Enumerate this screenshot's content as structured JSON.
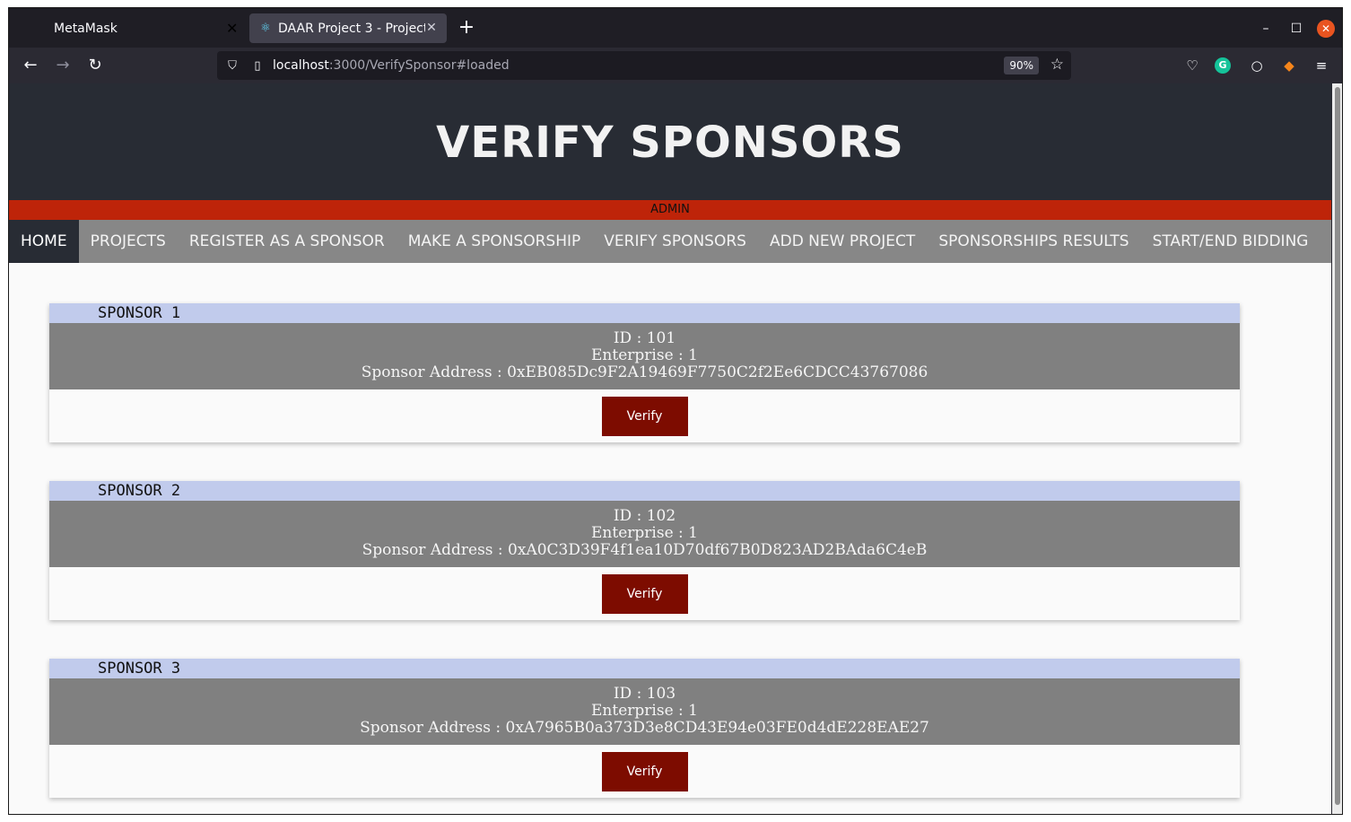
{
  "browser": {
    "tabs": [
      {
        "title": "MetaMask"
      },
      {
        "title": "DAAR Project 3 - Project"
      }
    ],
    "url_host": "localhost",
    "url_path": ":3000/VerifySponsor#loaded",
    "zoom": "90%"
  },
  "page": {
    "title": "VERIFY SPONSORS",
    "role": "ADMIN",
    "menu": [
      "HOME",
      "PROJECTS",
      "REGISTER AS A SPONSOR",
      "MAKE A SPONSORSHIP",
      "VERIFY SPONSORS",
      "ADD NEW PROJECT",
      "SPONSORSHIPS RESULTS",
      "START/END BIDDING"
    ],
    "active_menu": "HOME",
    "sponsors": [
      {
        "heading": "SPONSOR 1",
        "id_line": "ID : 101",
        "enterprise_line": "Enterprise : 1",
        "address_line": "Sponsor Address : 0xEB085Dc9F2A19469F7750C2f2Ee6CDCC43767086",
        "button_label": "Verify"
      },
      {
        "heading": "SPONSOR 2",
        "id_line": "ID : 102",
        "enterprise_line": "Enterprise : 1",
        "address_line": "Sponsor Address : 0xA0C3D39F4f1ea10D70df67B0D823AD2BAda6C4eB",
        "button_label": "Verify"
      },
      {
        "heading": "SPONSOR 3",
        "id_line": "ID : 103",
        "enterprise_line": "Enterprise : 1",
        "address_line": "Sponsor Address : 0xA7965B0a373D3e8CD43E94e03FE0d4dE228EAE27",
        "button_label": "Verify"
      }
    ]
  },
  "colors": {
    "header_bg": "#282c34",
    "admin_bar": "#be2409",
    "menu_bg": "#878787",
    "card_head": "#c1cbec",
    "card_body": "#808080",
    "verify_button": "#7d0c00"
  }
}
